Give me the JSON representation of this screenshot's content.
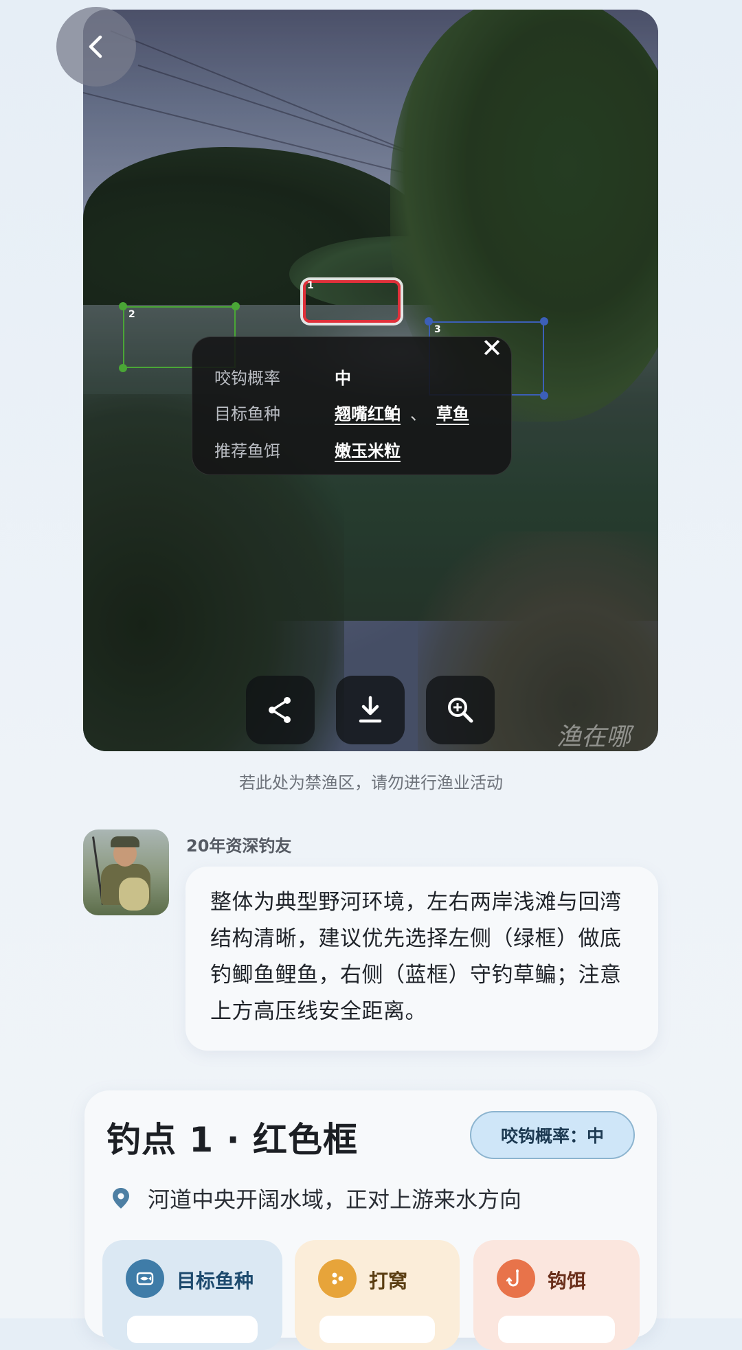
{
  "photo": {
    "watermark": "渔在哪",
    "spots": [
      {
        "num": "1",
        "color": "#e0303a"
      },
      {
        "num": "2",
        "color": "#4aa636"
      },
      {
        "num": "3",
        "color": "#3c5fb8"
      }
    ],
    "popup": {
      "rows": [
        {
          "key": "咬钩概率",
          "value": "中"
        },
        {
          "key": "目标鱼种",
          "links": [
            "翘嘴红鲌",
            "草鱼"
          ],
          "separator": "、"
        },
        {
          "key": "推荐鱼饵",
          "links": [
            "嫩玉米粒"
          ]
        }
      ]
    },
    "actions": [
      "share-icon",
      "download-icon",
      "zoom-in-icon"
    ]
  },
  "notice": "若此处为禁渔区，请勿进行渔业活动",
  "comment": {
    "author": "20年资深钓友",
    "text": "整体为典型野河环境，左右两岸浅滩与回湾结构清晰，建议优先选择左侧（绿框）做底钓鲫鱼鲤鱼，右侧（蓝框）守钓草鳊；注意上方高压线安全距离。"
  },
  "spot_card": {
    "title": "钓点 1 · 红色框",
    "probability": "咬钩概率：中",
    "location": "河道中央开阔水域，正对上游来水方向",
    "tiles": [
      {
        "label": "目标鱼种",
        "icon": "fish-icon",
        "bg": "#dbe8f3",
        "icon_bg": "#3f7ca8",
        "text_color": "#1d4a6e"
      },
      {
        "label": "打窝",
        "icon": "bait-dots-icon",
        "bg": "#fbedd9",
        "icon_bg": "#e7a43a",
        "text_color": "#5a3d12"
      },
      {
        "label": "钩饵",
        "icon": "hook-icon",
        "bg": "#fbe6de",
        "icon_bg": "#e8734a",
        "text_color": "#6a2f1b"
      }
    ]
  }
}
